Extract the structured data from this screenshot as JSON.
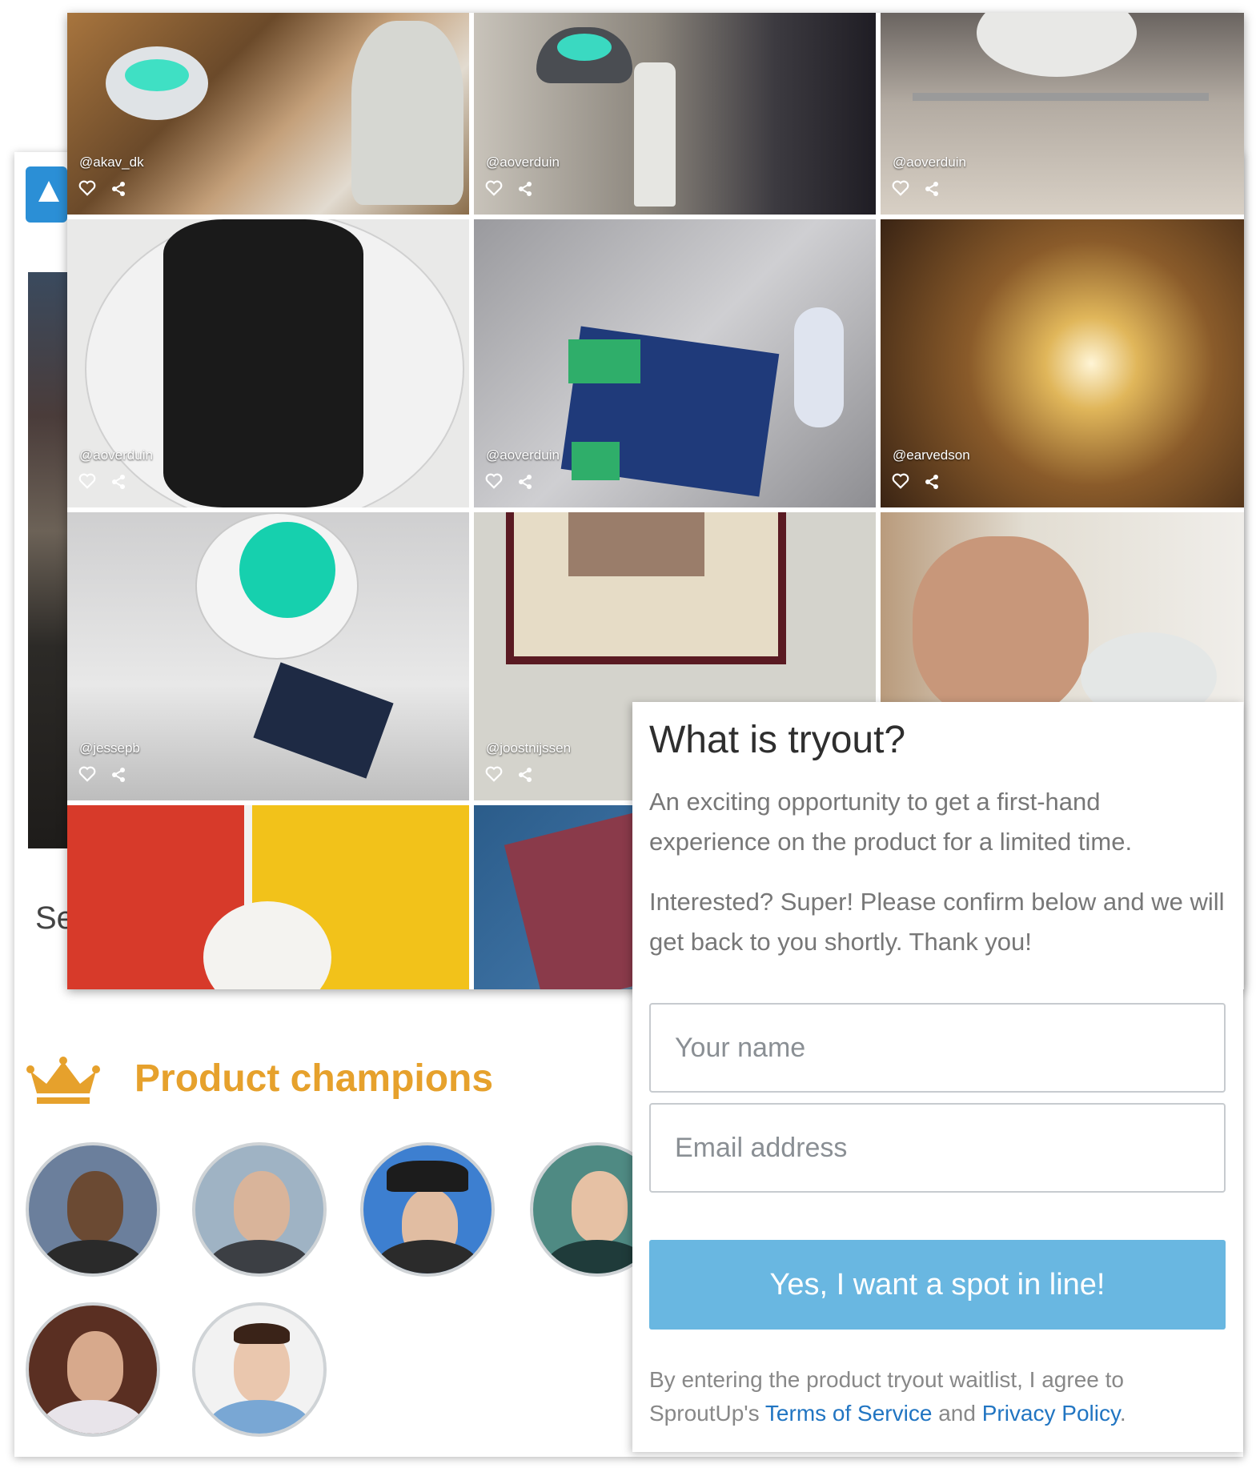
{
  "back_page": {
    "cut_off_text": "Se",
    "champions_title": "Product champions",
    "icons": {
      "logo": "app-logo-icon",
      "crown": "crown-icon"
    }
  },
  "gallery": {
    "tiles": [
      {
        "handle": "@akav_dk"
      },
      {
        "handle": "@aoverduin"
      },
      {
        "handle": "@aoverduin"
      },
      {
        "handle": "@aoverduin"
      },
      {
        "handle": "@aoverduin"
      },
      {
        "handle": "@earvedson"
      },
      {
        "handle": "@jessepb"
      },
      {
        "handle": "@joostnijssen"
      }
    ],
    "icons": {
      "like": "heart-icon",
      "share": "share-icon"
    }
  },
  "modal": {
    "title": "What is tryout?",
    "para1": "An exciting opportunity to get a first-hand experience on the product for a limited time.",
    "para2": "Interested? Super! Please confirm below and we will get back to you shortly. Thank you!",
    "name_placeholder": "Your name",
    "email_placeholder": "Email address",
    "submit_label": "Yes, I want a spot in line!",
    "legal_prefix": "By entering the product tryout waitlist, I agree to SproutUp's ",
    "terms_label": "Terms of Service",
    "legal_and": " and ",
    "privacy_label": "Privacy Policy",
    "legal_suffix": "."
  },
  "colors": {
    "accent_orange": "#e6a12c",
    "button_blue": "#69b7e1",
    "link_blue": "#2175c2"
  }
}
